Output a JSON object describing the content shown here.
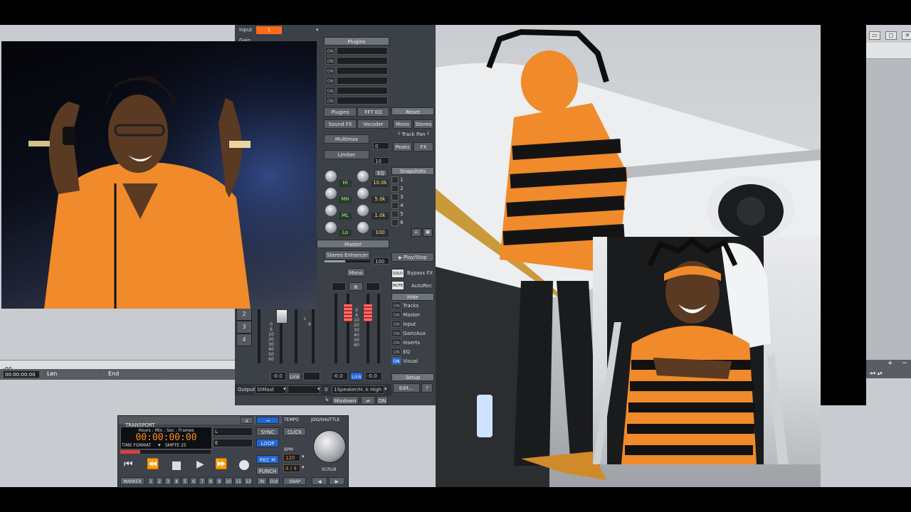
{
  "window": {
    "controls": [
      "▭",
      "◻",
      "✕"
    ]
  },
  "timeline": {
    "top_time": ":00",
    "start_time": "00:00:00:00",
    "len_label": "Len",
    "end_label": "End"
  },
  "right_ctrl": {
    "plus": "+",
    "minus": "−"
  },
  "mixer": {
    "input_label": "Input",
    "input_value": "1",
    "gain_label": "Gain",
    "plugins_header": "Plugins",
    "on_label": "ON",
    "tabs": {
      "plugins": "Plugins",
      "fft_eq": "FFT EQ",
      "sound_fx": "Sound FX",
      "vocoder": "Vocoder",
      "multimax": "Multimax",
      "limiter": "Limiter"
    },
    "multimax_value": "0",
    "limiter_value": "10",
    "reset": "Reset",
    "mono": "Mono",
    "stereo": "Stereo",
    "track_pan": "└ Track Pan ┘",
    "peaks": "Peaks",
    "fx": "FX",
    "eq_button": "EQ",
    "eq_bands": [
      {
        "label": "Hi",
        "value": "10.0k"
      },
      {
        "label": "MH",
        "value": "5.0k"
      },
      {
        "label": "ML",
        "value": "1.0k"
      },
      {
        "label": "Lo",
        "value": "100"
      }
    ],
    "snapshots_header": "Snapshots",
    "snapshots": [
      "1",
      "2",
      "3",
      "4",
      "5",
      "6"
    ],
    "master_header": "Master",
    "stereo_enhancer": "Stereo Enhancer",
    "stereo_enhancer_value": "100",
    "play_stop": "Play/Stop",
    "solo": "SOLO",
    "mute": "MUTE",
    "bypass_fx": "Bypass FX",
    "auto_rec": "AutoRec",
    "hide_header": "Hide",
    "hide_items": [
      "Tracks",
      "Master",
      "Input",
      "Gain/Aux",
      "Inserts",
      "EQ",
      "Visual"
    ],
    "mono_btn": "Mono",
    "n_btn": "N",
    "track_numbers": [
      "2",
      "3",
      "4"
    ],
    "fader_scale": [
      "0",
      "6",
      "10",
      "20",
      "30",
      "40",
      "50",
      "60"
    ],
    "meter_labels": [
      "L",
      "R"
    ],
    "minus_val_left": "-0.0",
    "link_left": "Link",
    "minus_val_m1": "-0.0",
    "link_master": "Link",
    "minus_val_m2": "-0.0",
    "setup_header": "Setup",
    "edit_btn": "Edit...",
    "help_btn": "?",
    "output_label": "Output",
    "output_value": "StMast",
    "output_device_value": "0",
    "output_device": "1Speaker/H..k High",
    "mixdown": "Mixdown",
    "arrow_glyph": "↳",
    "on_last": "ON"
  },
  "transport": {
    "title": "TRANSPORT",
    "close": "x",
    "arrow": "→",
    "time_caption": "Hours : Min : Sec : Frames",
    "time_value": "00:00:00:00",
    "time_format_label": "TIME FORMAT",
    "time_format_value": "SMPTE 25",
    "l_field": "L",
    "e_field": "E",
    "sync": "SYNC",
    "loop": "LOOP",
    "rec_m": "REC M",
    "punch": "PUNCH",
    "marker": "MARKER",
    "marker_numbers": [
      "1",
      "2",
      "3",
      "4",
      "5",
      "6",
      "7",
      "8",
      "9",
      "10",
      "11",
      "12"
    ],
    "in": "IN",
    "out": "Out",
    "tempo": "TEMPO",
    "click": "CLICK",
    "bpm_label": "BPM",
    "bpm": "120",
    "time_sig": "4 / 4",
    "snap": "SNAP",
    "jog_shuttle": "JOG/SHUTTLE",
    "scrub": "SCRUB",
    "rewind_glyph": "◀",
    "ffwd_glyph": "▶",
    "colors": {
      "time_digits": "#ff8c1a",
      "loop_active": "#1f66d6"
    }
  },
  "colors": {
    "input_orange": "#ff6a1a",
    "accent_blue": "#1f66d6",
    "eq_green": "#9ff29a",
    "eq_yellow": "#ffe16b"
  }
}
